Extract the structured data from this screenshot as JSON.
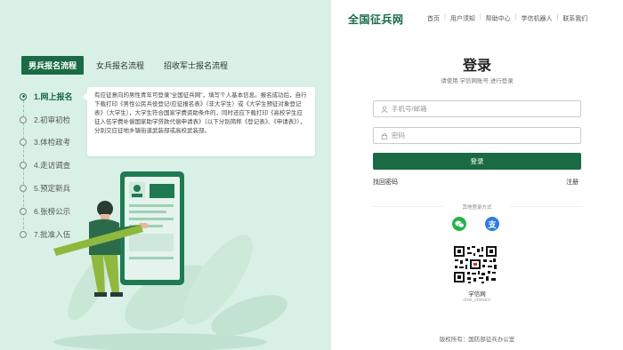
{
  "header": {
    "logo": "全国征兵网",
    "nav": [
      "首页",
      "用户须知",
      "帮助中心",
      "学信机器人",
      "联系我们"
    ]
  },
  "left": {
    "tabs": [
      "男兵报名流程",
      "女兵报名流程",
      "招收军士报名流程"
    ],
    "steps": [
      "1.网上报名",
      "2.初审初检",
      "3.体检政考",
      "4.走访调查",
      "5.预定新兵",
      "6.张榜公示",
      "7.批准入伍"
    ],
    "tip": "有应征意向的男性青年可登录\"全国征兵网\"，填写个人基本信息。报名成功后，自行下载打印《男性公民兵役登记/应征报名表》（非大学生）或《大学生预征对象登记表》（大学生），大学生符合国家学费资助条件的，同时还应下载打印《高校学生应征入伍学费补偿国家助学贷款代偿申请表》（以下分别简称《登记表》、《申请表》），分别交应征地乡镇街道武装部或高校武装部。"
  },
  "login": {
    "title": "登录",
    "subtitle": "请使用 学信网账号 进行登录",
    "username_placeholder": "手机号/邮箱",
    "password_placeholder": "密码",
    "button": "登录",
    "forgot": "找回密码",
    "register": "注册",
    "other_methods": "其他登录方式",
    "alipay_glyph": "支",
    "qr_name": "学信网",
    "qr_id": "chsi_chesicc"
  },
  "footer": "版权所有：国防部征兵办公室",
  "colors": {
    "brand": "#1a6b45",
    "left_bg": "#d9f0e6",
    "wechat": "#28b24a",
    "alipay": "#2a7de1"
  }
}
